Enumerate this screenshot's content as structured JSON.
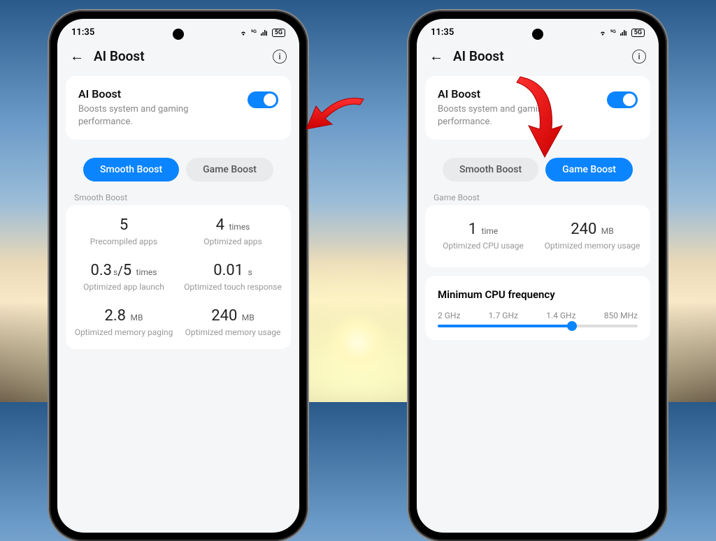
{
  "statusbar": {
    "time": "11:35",
    "network_badge": "5G"
  },
  "header": {
    "title": "AI Boost"
  },
  "aiboost_card": {
    "title": "AI Boost",
    "description": "Boosts system and gaming performance.",
    "toggle_on": true
  },
  "tabs": {
    "smooth": "Smooth Boost",
    "game": "Game Boost"
  },
  "left_phone": {
    "active_tab": "smooth",
    "section_label": "Smooth Boost",
    "stats": [
      {
        "value": "5",
        "unit": "",
        "label": "Precompiled apps"
      },
      {
        "value": "4",
        "unit": "times",
        "label": "Optimized apps"
      },
      {
        "value": "0.3",
        "unit": "s",
        "value2": "5",
        "unit2": "times",
        "label": "Optimized app launch"
      },
      {
        "value": "0.01",
        "unit": "s",
        "label": "Optimized touch response"
      },
      {
        "value": "2.8",
        "unit": "MB",
        "label": "Optimized memory paging"
      },
      {
        "value": "240",
        "unit": "MB",
        "label": "Optimized memory usage"
      }
    ]
  },
  "right_phone": {
    "active_tab": "game",
    "section_label": "Game Boost",
    "stats": [
      {
        "value": "1",
        "unit": "time",
        "label": "Optimized CPU usage"
      },
      {
        "value": "240",
        "unit": "MB",
        "label": "Optimized memory usage"
      }
    ],
    "cpu": {
      "title": "Minimum CPU frequency",
      "ticks": [
        "2 GHz",
        "1.7 GHz",
        "1.4 GHz",
        "850 MHz"
      ],
      "selected_index": 2
    }
  }
}
